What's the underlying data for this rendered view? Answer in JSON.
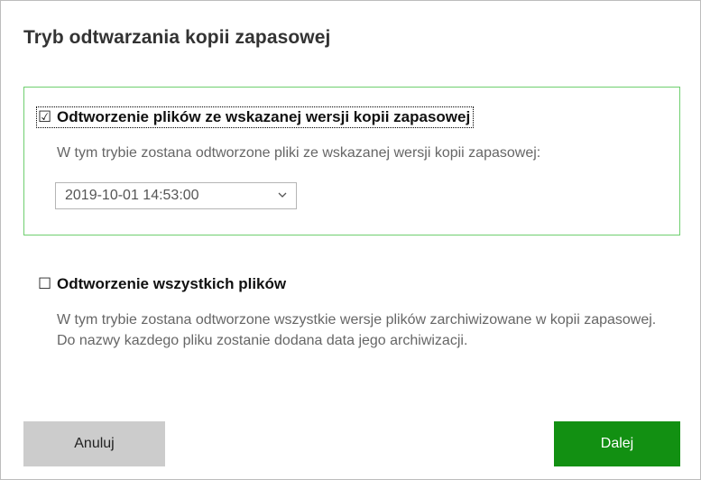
{
  "dialog": {
    "title": "Tryb odtwarzania kopii zapasowej"
  },
  "options": [
    {
      "checked": true,
      "checkbox_glyph": "☑",
      "title": "Odtworzenie plików ze wskazanej wersji kopii zapasowej",
      "description": "W tym trybie zostana odtworzone pliki ze wskazanej wersji kopii zapasowej:",
      "version_select": {
        "value": "2019-10-01 14:53:00"
      }
    },
    {
      "checked": false,
      "checkbox_glyph": "☐",
      "title": "Odtworzenie wszystkich plików",
      "description": "W tym trybie zostana odtworzone wszystkie wersje plików zarchiwizowane w kopii zapasowej. Do nazwy kazdego pliku zostanie dodana data jego archiwizacji."
    }
  ],
  "buttons": {
    "cancel_label": "Anuluj",
    "next_label": "Dalej"
  },
  "colors": {
    "accent_green": "#129012",
    "selected_border": "#6fcf6f",
    "cancel_gray": "#cccccc"
  },
  "icons": {
    "select_arrow": "chevron-down-icon"
  }
}
